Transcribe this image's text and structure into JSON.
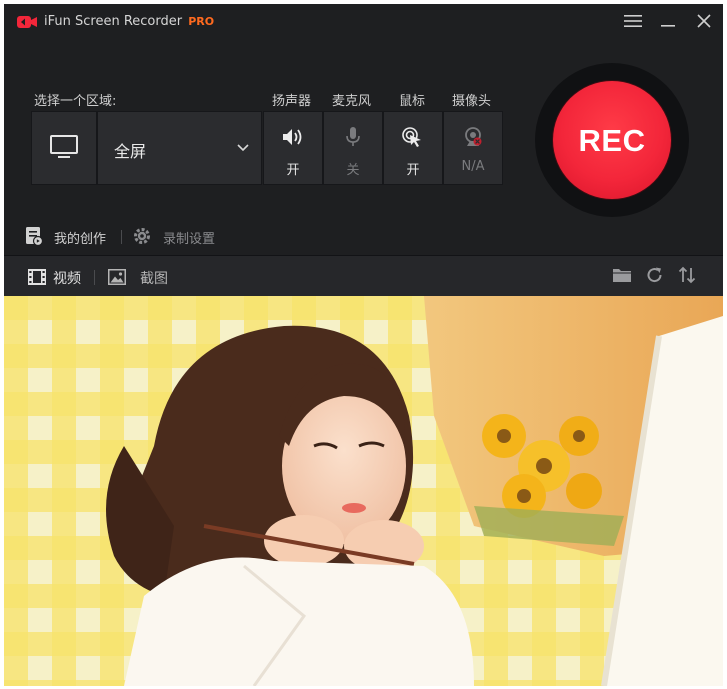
{
  "app": {
    "title": "iFun Screen Recorder",
    "edition": "PRO"
  },
  "region": {
    "label": "选择一个区域:",
    "value": "全屏"
  },
  "devices": [
    {
      "label": "扬声器",
      "state": "开"
    },
    {
      "label": "麦克风",
      "state": "关"
    },
    {
      "label": "鼠标",
      "state": "开"
    },
    {
      "label": "摄像头",
      "state": "N/A"
    }
  ],
  "record_button": {
    "label": "REC"
  },
  "links": {
    "my_creations": "我的创作",
    "record_settings": "录制设置"
  },
  "tabs": {
    "video": "视频",
    "screenshot": "截图"
  },
  "colors": {
    "accent": "#f3263a",
    "pro": "#ff6a1f",
    "window_bg": "#1e1f21"
  }
}
